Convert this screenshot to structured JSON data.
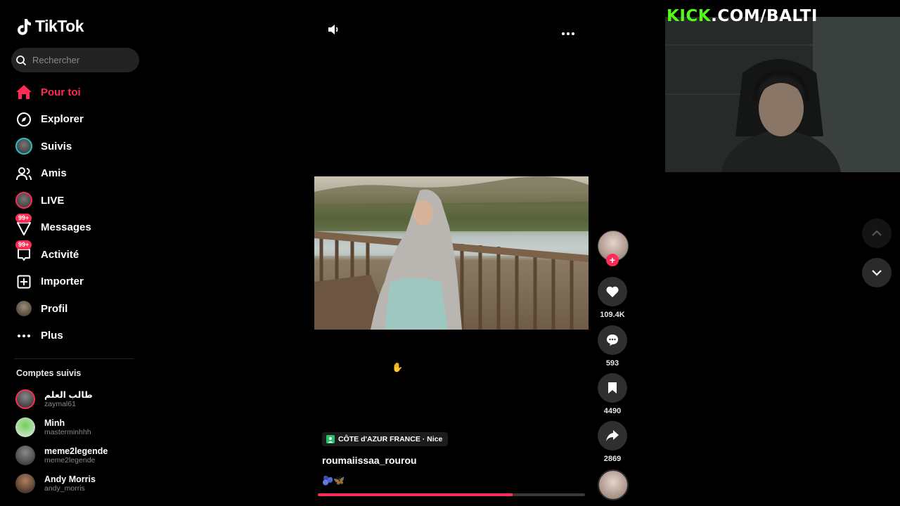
{
  "app": {
    "name": "TikTok"
  },
  "search": {
    "placeholder": "Rechercher"
  },
  "nav": {
    "items": [
      {
        "label": "Pour toi",
        "icon": "home-icon",
        "active": true
      },
      {
        "label": "Explorer",
        "icon": "compass-icon"
      },
      {
        "label": "Suivis",
        "icon": "following-avatar-icon"
      },
      {
        "label": "Amis",
        "icon": "friends-icon"
      },
      {
        "label": "LIVE",
        "icon": "live-avatar-icon"
      },
      {
        "label": "Messages",
        "icon": "messages-icon",
        "badge": "99+"
      },
      {
        "label": "Activité",
        "icon": "activity-icon",
        "badge": "99+"
      },
      {
        "label": "Importer",
        "icon": "upload-icon"
      },
      {
        "label": "Profil",
        "icon": "profile-avatar-icon"
      },
      {
        "label": "Plus",
        "icon": "more-icon"
      }
    ]
  },
  "following": {
    "title": "Comptes suivis",
    "accounts": [
      {
        "name": "طالب العلم",
        "handle": "zaymal61",
        "live": true
      },
      {
        "name": "Minh",
        "handle": "masterminhhh"
      },
      {
        "name": "meme2legende",
        "handle": "meme2legende"
      },
      {
        "name": "Andy Morris",
        "handle": "andy_morris"
      }
    ]
  },
  "video": {
    "location": "CÔTE d'AZUR FRANCE · Nice",
    "username": "roumaiissaa_rourou",
    "caption": "🫐🦋",
    "progress": 0.73,
    "stats": {
      "likes": "109.4K",
      "comments": "593",
      "saves": "4490",
      "shares": "2869"
    }
  },
  "overlay": {
    "kick_brand": "KICK",
    "kick_rest": ".COM/BALTI"
  },
  "colors": {
    "accent": "#fe2c55",
    "kick_green": "#53fc18",
    "background": "#000000"
  }
}
